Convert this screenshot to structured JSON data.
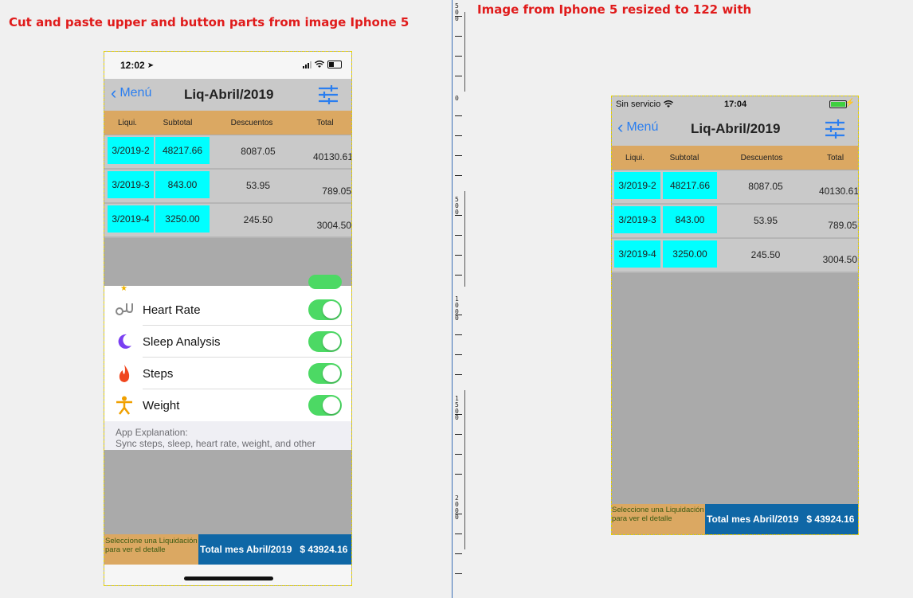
{
  "captions": {
    "left": "Cut and paste upper and button parts from image Iphone 5",
    "right": "Image from Iphone 5 resized to 122 with"
  },
  "ruler": {
    "labels": [
      "5 0 0",
      "0",
      "5 0 0",
      "1 0 0 0",
      "1 5 0 0",
      "2 0 0 0"
    ]
  },
  "left_phone": {
    "status_time": "12:02",
    "nav": {
      "back_label": "Menú",
      "title": "Liq-Abril/2019"
    },
    "columns": [
      "Liqui.",
      "Subtotal",
      "Descuentos",
      "Total"
    ],
    "rows": [
      {
        "liqui": "3/2019-2",
        "subtotal": "48217.66",
        "descuentos": "8087.05",
        "total": "40130.61"
      },
      {
        "liqui": "3/2019-3",
        "subtotal": "843.00",
        "descuentos": "53.95",
        "total": "789.05"
      },
      {
        "liqui": "3/2019-4",
        "subtotal": "3250.00",
        "descuentos": "245.50",
        "total": "3004.50"
      }
    ],
    "list_items": [
      {
        "label": "Heart Rate",
        "icon": "stethoscope-icon",
        "enabled": true
      },
      {
        "label": "Sleep Analysis",
        "icon": "moon-icon",
        "enabled": true
      },
      {
        "label": "Steps",
        "icon": "flame-icon",
        "enabled": true
      },
      {
        "label": "Weight",
        "icon": "person-icon",
        "enabled": true
      }
    ],
    "explanation_title": "App Explanation:",
    "explanation_text": "Sync steps, sleep, heart rate, weight, and other",
    "footer": {
      "hint": "Seleccione una Liquidación para ver el detalle",
      "total_label": "Total mes Abril/2019",
      "total_value": "$ 43924.16"
    }
  },
  "right_phone": {
    "carrier": "Sin servicio",
    "status_time": "17:04",
    "nav": {
      "back_label": "Menú",
      "title": "Liq-Abril/2019"
    },
    "columns": [
      "Liqui.",
      "Subtotal",
      "Descuentos",
      "Total"
    ],
    "rows": [
      {
        "liqui": "3/2019-2",
        "subtotal": "48217.66",
        "descuentos": "8087.05",
        "total": "40130.61"
      },
      {
        "liqui": "3/2019-3",
        "subtotal": "843.00",
        "descuentos": "53.95",
        "total": "789.05"
      },
      {
        "liqui": "3/2019-4",
        "subtotal": "3250.00",
        "descuentos": "245.50",
        "total": "3004.50"
      }
    ],
    "footer": {
      "hint": "Seleccione una Liquidación para ver el detalle",
      "total_label": "Total mes Abril/2019",
      "total_value": "$ 43924.16"
    }
  },
  "colors": {
    "header_orange": "#dba862",
    "highlight_cyan": "#00ffff",
    "footer_blue": "#0f67a6",
    "ios_blue": "#2a7ef0",
    "toggle_green": "#4cd964",
    "caption_red": "#e01b1b"
  }
}
